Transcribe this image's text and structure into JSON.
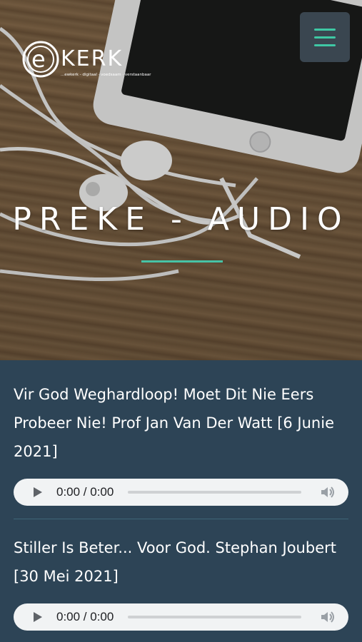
{
  "header": {
    "logo_letter": "e",
    "logo_wordmark": "KERK",
    "logo_tagline": "...ewkerk - digitaal · voedsaam · verstaanbaar",
    "menu_icon": "hamburger-icon",
    "accent_color": "#3fc8a4"
  },
  "page": {
    "title": "PREKE - AUDIO"
  },
  "sermons": [
    {
      "title": "Vir God Weghardloop! Moet Dit Nie Eers Probeer Nie! Prof Jan Van Der Watt [6 Junie 2021]",
      "player": {
        "time": "0:00 / 0:00",
        "progress": 0
      }
    },
    {
      "title": "Stiller Is Beter... Voor God. Stephan Joubert [30 Mei 2021]",
      "player": {
        "time": "0:00 / 0:00",
        "progress": 0
      }
    }
  ]
}
